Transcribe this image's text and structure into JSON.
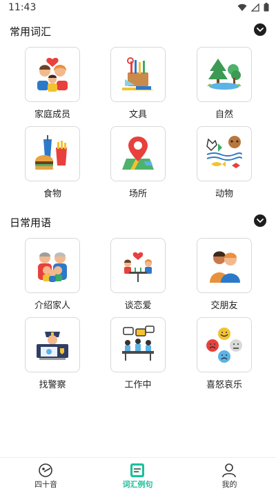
{
  "status_bar": {
    "time": "11:43"
  },
  "sections": [
    {
      "title": "常用词汇",
      "items": [
        {
          "label": "家庭成员",
          "icon": "family-icon"
        },
        {
          "label": "文具",
          "icon": "stationery-icon"
        },
        {
          "label": "自然",
          "icon": "nature-icon"
        },
        {
          "label": "食物",
          "icon": "food-icon"
        },
        {
          "label": "场所",
          "icon": "map-pin-icon"
        },
        {
          "label": "动物",
          "icon": "animals-icon"
        }
      ]
    },
    {
      "title": "日常用语",
      "items": [
        {
          "label": "介绍家人",
          "icon": "introduce-family-icon"
        },
        {
          "label": "谈恋爱",
          "icon": "date-icon"
        },
        {
          "label": "交朋友",
          "icon": "friends-icon"
        },
        {
          "label": "找警察",
          "icon": "police-icon"
        },
        {
          "label": "工作中",
          "icon": "meeting-icon"
        },
        {
          "label": "喜怒哀乐",
          "icon": "emotions-icon"
        }
      ]
    }
  ],
  "bottom_nav": [
    {
      "label": "四十音",
      "icon": "kana-icon",
      "active": false
    },
    {
      "label": "词汇例句",
      "icon": "vocab-icon",
      "active": true
    },
    {
      "label": "我的",
      "icon": "profile-icon",
      "active": false
    }
  ],
  "colors": {
    "accent": "#1bbf9c",
    "toggle": "#1e1e1e",
    "tile_border": "#d8d8d8"
  }
}
